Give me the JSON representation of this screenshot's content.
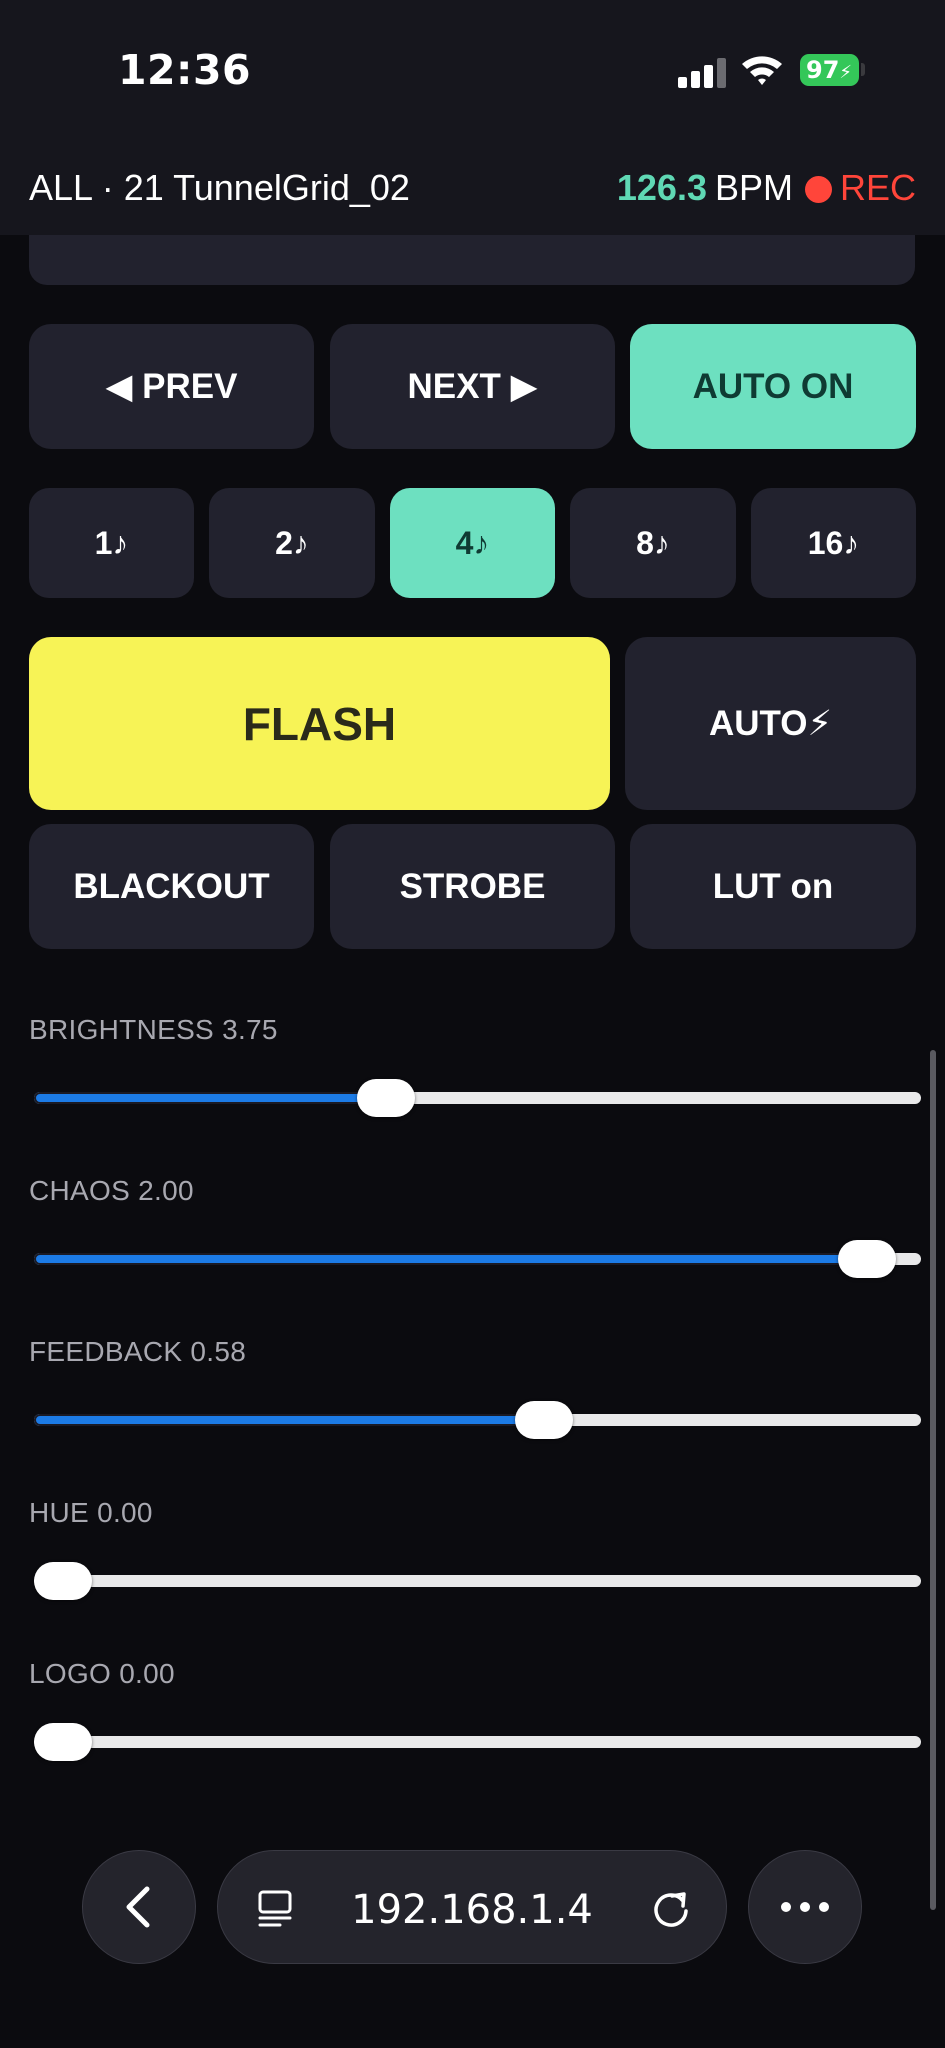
{
  "status_bar": {
    "time": "12:36",
    "battery": "97",
    "icons": [
      "cellular-signal-icon",
      "wifi-icon",
      "battery-charging-icon"
    ]
  },
  "header": {
    "title": "ALL · 21 TunnelGrid_02",
    "bpm_value": "126.3",
    "bpm_unit": "BPM",
    "rec_label": "REC"
  },
  "nav_buttons": {
    "prev": "◀ PREV",
    "next": "NEXT ▶",
    "auto": "AUTO ON"
  },
  "divisions": [
    {
      "label": "1♪",
      "active": false
    },
    {
      "label": "2♪",
      "active": false
    },
    {
      "label": "4♪",
      "active": true
    },
    {
      "label": "8♪",
      "active": false
    },
    {
      "label": "16♪",
      "active": false
    }
  ],
  "flash": {
    "label": "FLASH",
    "auto_label": "AUTO⚡"
  },
  "effects": {
    "blackout": "BLACKOUT",
    "strobe": "STROBE",
    "lut": "LUT on"
  },
  "sliders": [
    {
      "label": "BRIGHTNESS 3.75",
      "fraction": 0.39
    },
    {
      "label": "CHAOS 2.00",
      "fraction": 0.97
    },
    {
      "label": "FEEDBACK 0.58",
      "fraction": 0.58
    },
    {
      "label": "HUE 0.00",
      "fraction": 0.0
    },
    {
      "label": "LOGO 0.00",
      "fraction": 0.0
    }
  ],
  "browser": {
    "url": "192.168.1.4",
    "icons": [
      "back-icon",
      "reader-icon",
      "reload-icon",
      "more-icon"
    ]
  },
  "colors": {
    "accent": "#6de0c0",
    "flash": "#f7f356",
    "rec": "#ff453a",
    "slider_fill": "#1c7be6",
    "bpm": "#5fd8b4"
  }
}
